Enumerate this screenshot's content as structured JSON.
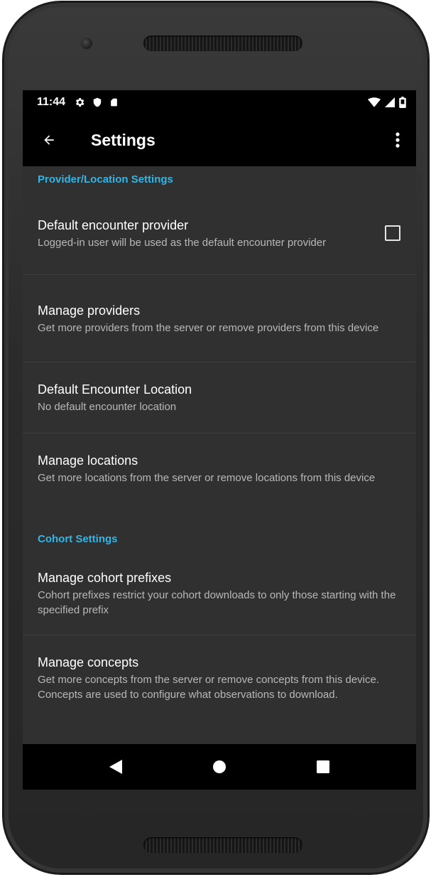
{
  "status_bar": {
    "time": "11:44",
    "left_icons": [
      "settings-icon",
      "shield-icon",
      "sd-card-icon"
    ],
    "right_icons": [
      "wifi-icon",
      "signal-icon",
      "battery-icon"
    ]
  },
  "app_bar": {
    "title": "Settings",
    "back_icon": "arrow-back-icon",
    "menu_icon": "more-vert-icon"
  },
  "colors": {
    "accent": "#33b5e5",
    "background": "#303030",
    "bar": "#000000"
  },
  "categories": [
    {
      "title": "Provider/Location Settings",
      "items": [
        {
          "title": "Default encounter provider",
          "summary": "Logged-in user will be used as the default encounter provider",
          "checkbox": true,
          "checked": false
        },
        {
          "title": "Manage providers",
          "summary": "Get more providers from the server or remove providers from this device"
        },
        {
          "title": "Default Encounter Location",
          "summary": "No default encounter location"
        },
        {
          "title": "Manage locations",
          "summary": "Get more locations from the server or remove locations from this device"
        }
      ]
    },
    {
      "title": "Cohort Settings",
      "items": [
        {
          "title": "Manage cohort prefixes",
          "summary": "Cohort prefixes restrict your cohort downloads to only those starting with the specified prefix"
        },
        {
          "title": "Manage concepts",
          "summary": "Get more concepts from the server or remove concepts from this device. Concepts are used to configure what observations to download."
        }
      ]
    }
  ],
  "nav_bar": [
    "back-triangle-icon",
    "home-circle-icon",
    "recents-square-icon"
  ]
}
